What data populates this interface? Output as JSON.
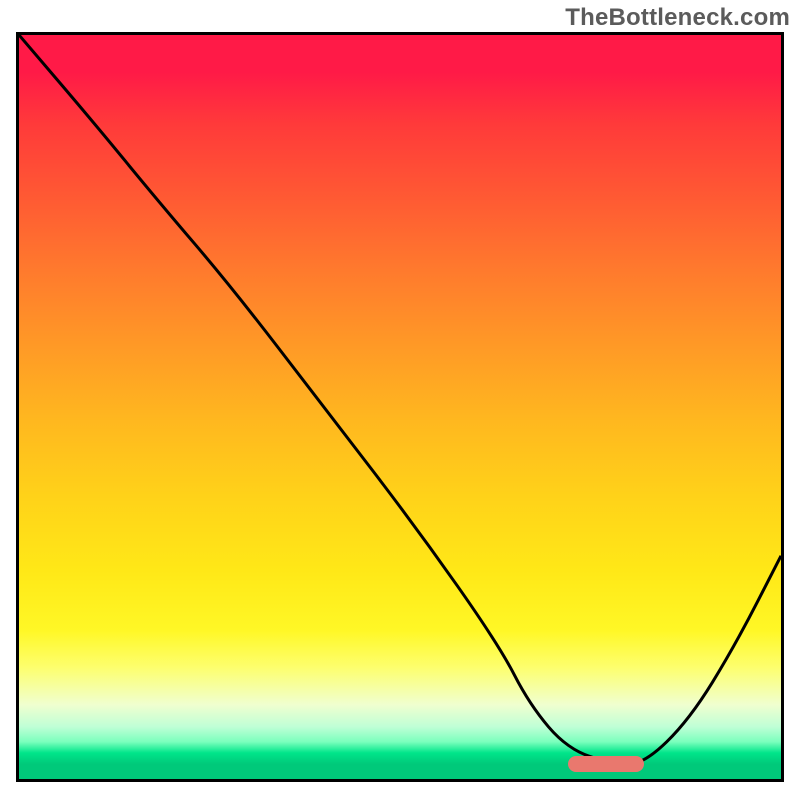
{
  "watermark": "TheBottleneck.com",
  "chart_data": {
    "type": "line",
    "title": "",
    "xlabel": "",
    "ylabel": "",
    "xlim": [
      0,
      100
    ],
    "ylim": [
      0,
      100
    ],
    "series": [
      {
        "name": "curve",
        "x": [
          0,
          10,
          18,
          28,
          40,
          52,
          63,
          67,
          72,
          78,
          82,
          88,
          94,
          100
        ],
        "y": [
          100,
          88,
          78,
          66,
          50,
          34,
          18,
          10,
          4,
          2,
          2,
          8,
          18,
          30
        ]
      }
    ],
    "optimal_band_x": [
      72,
      82
    ],
    "marker_y": 2,
    "gradient_stops": [
      {
        "pos": 0.0,
        "color": "#ff1a47"
      },
      {
        "pos": 0.5,
        "color": "#ffb81f"
      },
      {
        "pos": 0.8,
        "color": "#fff726"
      },
      {
        "pos": 0.95,
        "color": "#7bffbd"
      },
      {
        "pos": 1.0,
        "color": "#00c97a"
      }
    ]
  }
}
